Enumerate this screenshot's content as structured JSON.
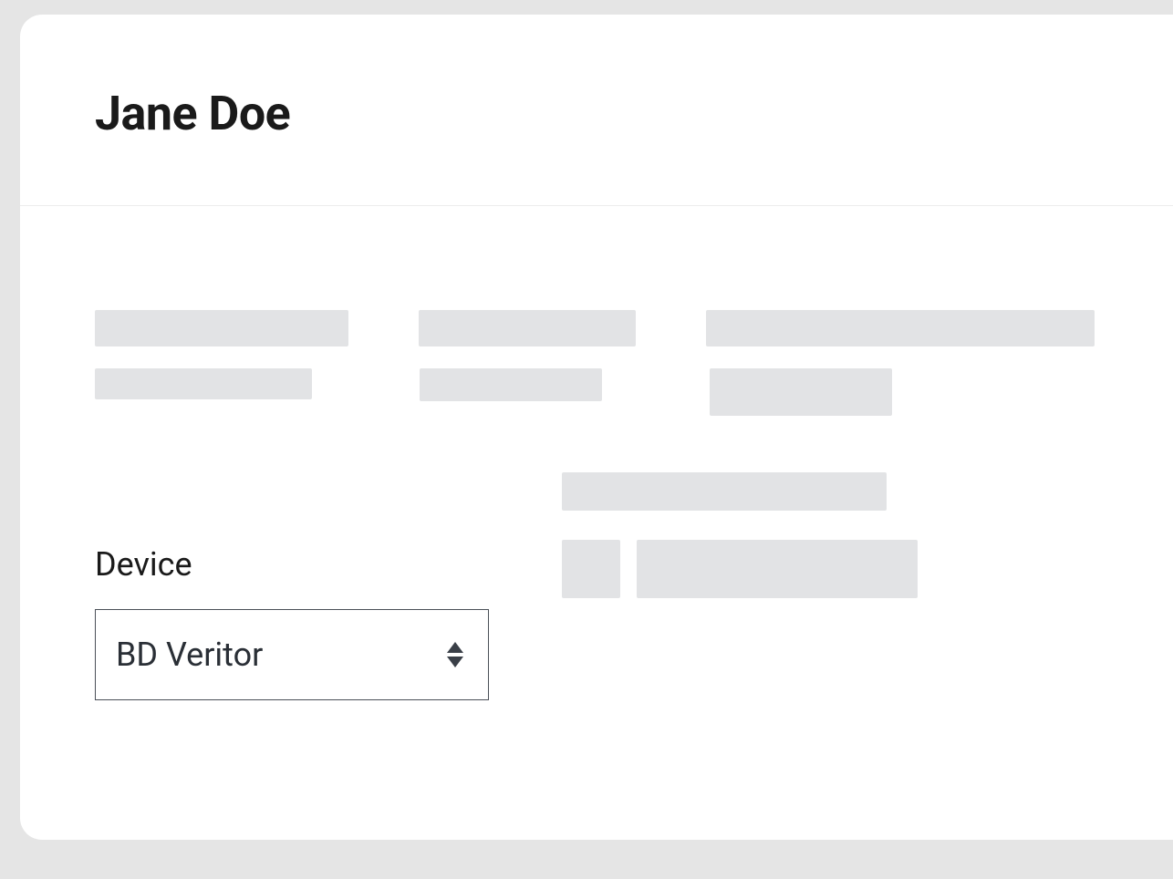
{
  "header": {
    "title": "Jane Doe"
  },
  "form": {
    "device": {
      "label": "Device",
      "selected": "BD Veritor"
    }
  }
}
